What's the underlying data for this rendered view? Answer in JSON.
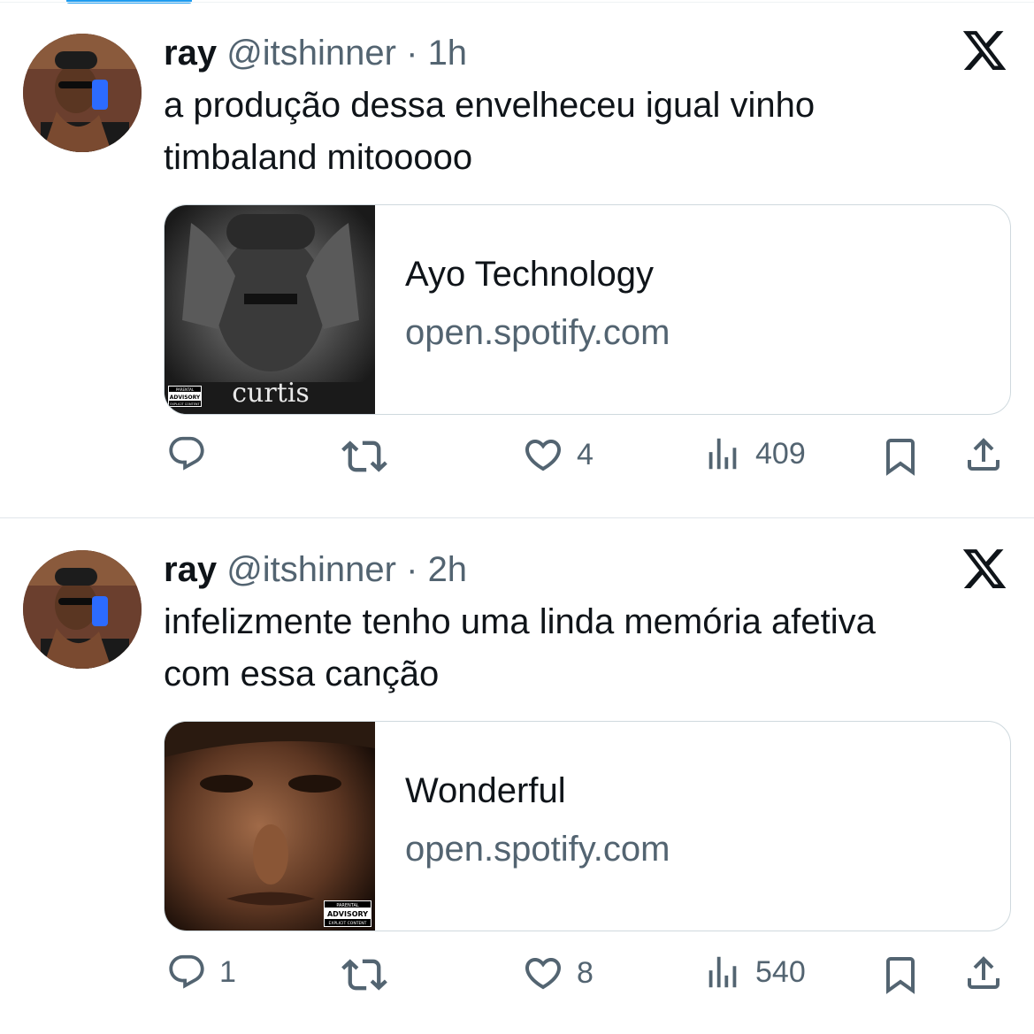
{
  "tweets": [
    {
      "name": "ray",
      "handle": "@itshinner",
      "separator": "·",
      "time": "1h",
      "text": "a produção dessa envelheceu igual vinho\ntimbaland mitooooo",
      "card": {
        "title": "Ayo Technology",
        "domain": "open.spotify.com",
        "album_text": "curtis",
        "advisory_top": "PARENTAL",
        "advisory_main": "ADVISORY",
        "advisory_bottom": "EXPLICIT CONTENT"
      },
      "replies": "",
      "likes": "4",
      "views": "409"
    },
    {
      "name": "ray",
      "handle": "@itshinner",
      "separator": "·",
      "time": "2h",
      "text": "infelizmente tenho uma linda memória afetiva\ncom essa canção",
      "card": {
        "title": "Wonderful",
        "domain": "open.spotify.com",
        "advisory_top": "PARENTAL",
        "advisory_main": "ADVISORY",
        "advisory_bottom": "EXPLICIT CONTENT"
      },
      "replies": "1",
      "likes": "8",
      "views": "540"
    }
  ],
  "icons": {
    "reply": "reply-icon",
    "retweet": "retweet-icon",
    "like": "like-icon",
    "views": "views-icon",
    "bookmark": "bookmark-icon",
    "share": "share-icon",
    "source": "x-logo-icon"
  },
  "colors": {
    "text": "#0f1419",
    "secondary": "#536471",
    "border": "#cfd9de",
    "accent": "#1d9bf0"
  }
}
